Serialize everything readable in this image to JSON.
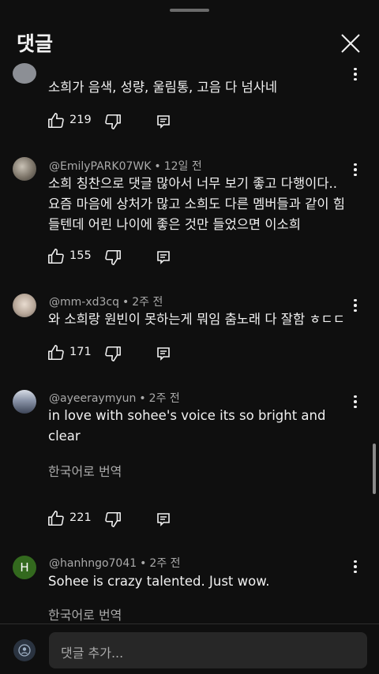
{
  "header": {
    "title": "댓글"
  },
  "comments": [
    {
      "author": "",
      "time": "",
      "text": "소희가 음색, 성량, 울림통, 고음 다 넘사네",
      "likes": "219"
    },
    {
      "author": "@EmilyPARK07WK",
      "time": "12일 전",
      "text_lines": [
        "소희 칭찬으로 댓글 많아서 너무 보기 좋고 다행이다..",
        "요즘 마음에 상처가 많고 소희도 다른 멤버들과 같이 힘",
        "들텐데 어린 나이에 좋은 것만 들었으면 이소희"
      ],
      "likes": "155"
    },
    {
      "author": "@mm-xd3cq",
      "time": "2주 전",
      "text": "와 소희랑 원빈이 못하는게 뭐임 춤노래 다 잘함 ㅎㄷㄷ",
      "likes": "171"
    },
    {
      "author": "@ayeeraymyun",
      "time": "2주 전",
      "text_lines": [
        "in love with sohee's voice its so bright and",
        "clear"
      ],
      "translate": "한국어로 번역",
      "likes": "221"
    },
    {
      "author": "@hanhngo7041",
      "time": "2주 전",
      "avatar_letter": "H",
      "text": "Sohee is crazy talented. Just wow.",
      "translate": "한국어로 번역"
    }
  ],
  "footer": {
    "placeholder": "댓글 추가..."
  },
  "colors": {
    "background": "#0f0f0f",
    "text": "#f1f1f1",
    "secondary": "#aaaaaa",
    "avatar_green": "#33691e"
  }
}
